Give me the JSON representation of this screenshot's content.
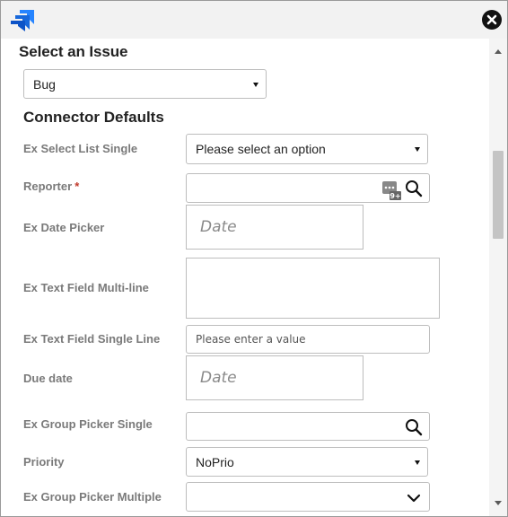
{
  "header": {
    "logo_icon": "jira-logo-icon",
    "close_icon": "close-circle-icon",
    "brand_color": "#2684ff"
  },
  "issue": {
    "heading": "Select an Issue",
    "type_value": "Bug"
  },
  "connector": {
    "heading": "Connector Defaults",
    "fields": {
      "select_list_single": {
        "label": "Ex Select List Single",
        "value": "Please select an option"
      },
      "reporter": {
        "label": "Reporter",
        "required_mark": "*",
        "icons": [
          "user-picker-icon",
          "search-icon"
        ],
        "badge": "9+"
      },
      "date_picker": {
        "label": "Ex Date Picker",
        "placeholder": "Date"
      },
      "text_multi": {
        "label": "Ex Text Field Multi-line"
      },
      "text_single": {
        "label": "Ex Text Field Single Line",
        "placeholder": "Please enter a value"
      },
      "due_date": {
        "label": "Due date",
        "placeholder": "Date"
      },
      "group_picker_single": {
        "label": "Ex Group Picker Single",
        "icon": "search-icon"
      },
      "priority": {
        "label": "Priority",
        "value": "NoPrio"
      },
      "group_picker_multiple": {
        "label": "Ex Group Picker Multiple",
        "icon": "chevron-down-icon"
      }
    }
  }
}
